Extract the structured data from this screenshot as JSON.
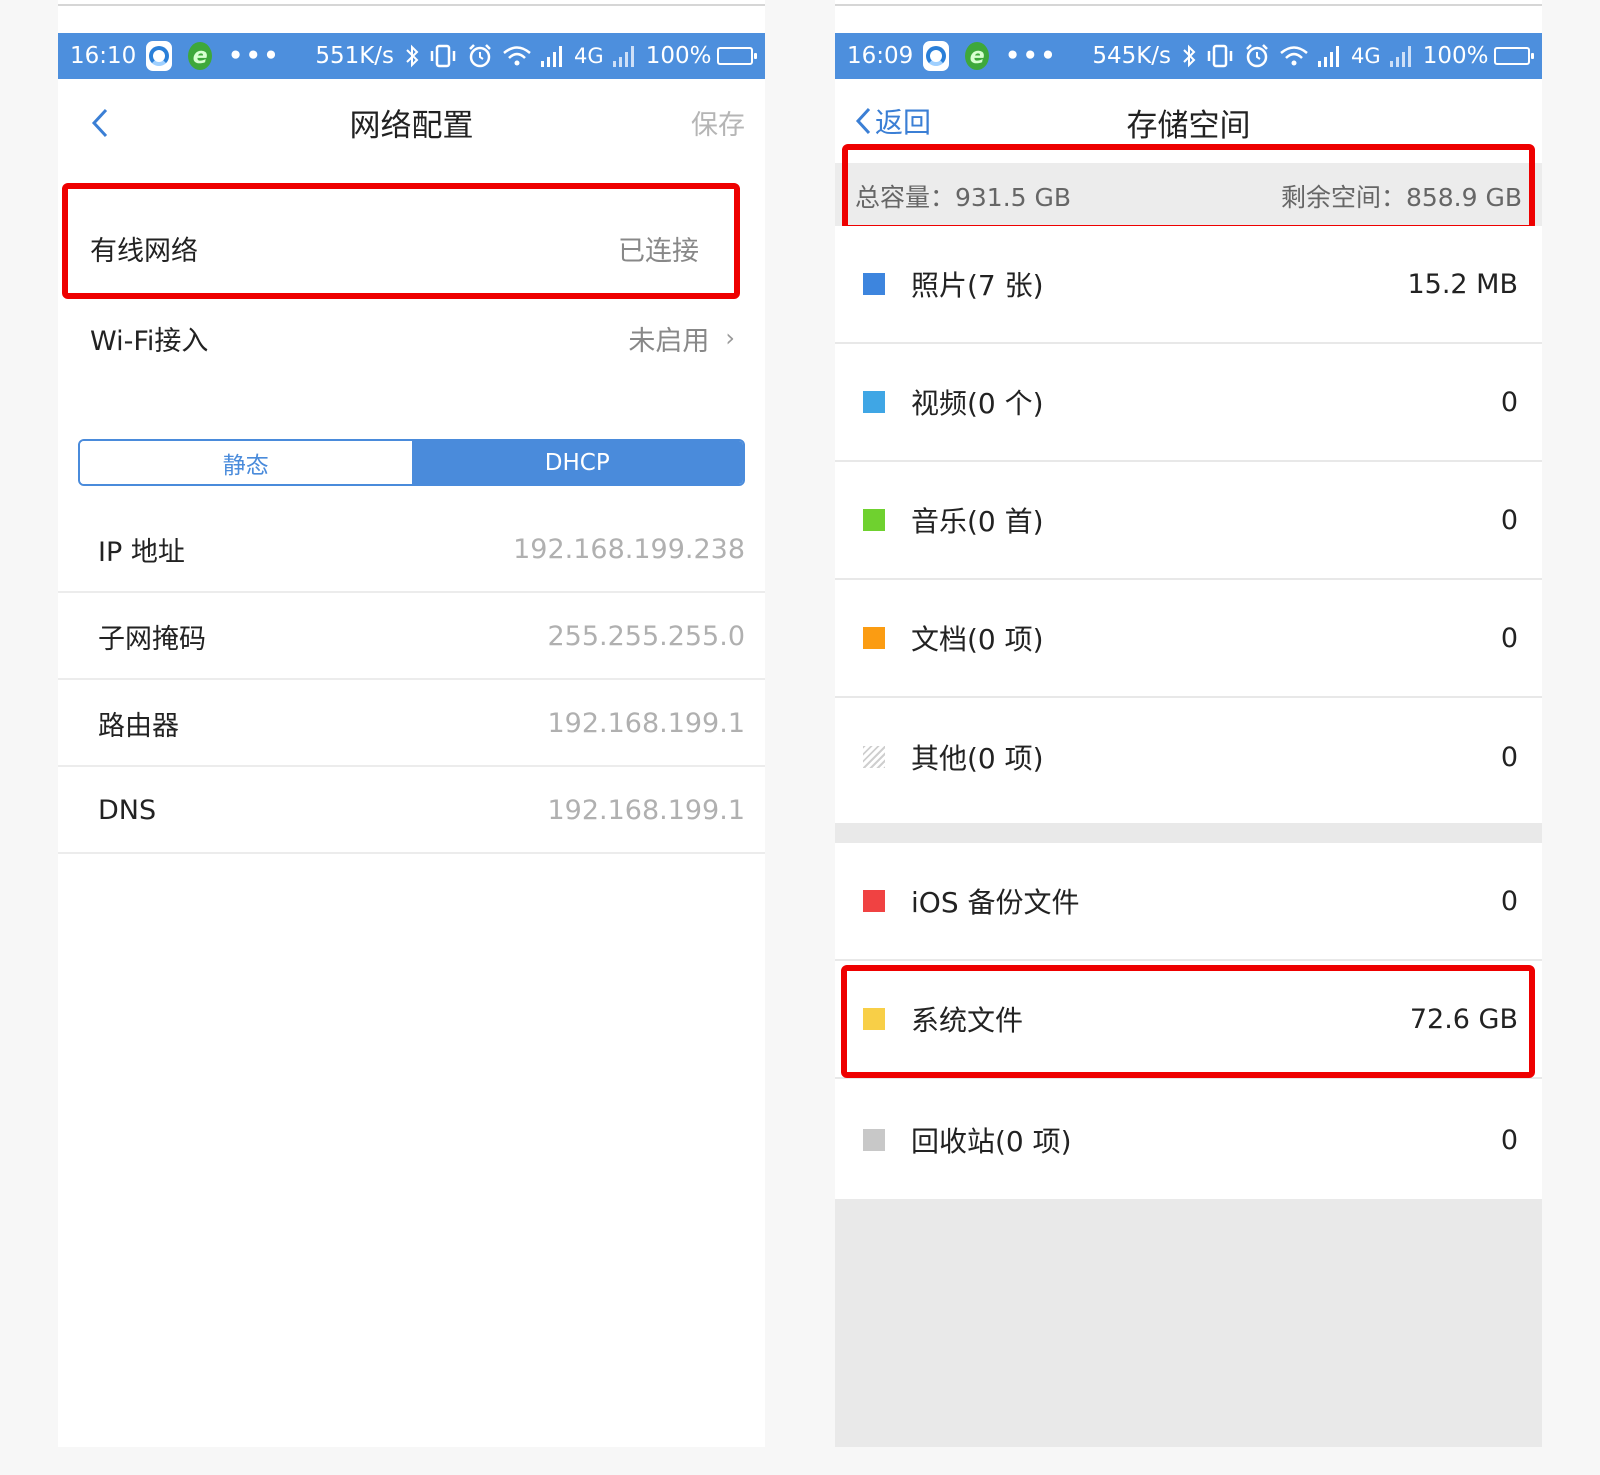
{
  "left": {
    "status": {
      "time": "16:10",
      "speed": "551K/s",
      "network": "4G",
      "battery": "100%"
    },
    "title": "网络配置",
    "save_label": "保存",
    "wired": {
      "label": "有线网络",
      "value": "已连接"
    },
    "wifi": {
      "label": "Wi-Fi接入",
      "value": "未启用"
    },
    "segments": {
      "static": "静态",
      "dhcp": "DHCP",
      "selected": "DHCP"
    },
    "rows": [
      {
        "label": "IP 地址",
        "value": "192.168.199.238"
      },
      {
        "label": "子网掩码",
        "value": "255.255.255.0"
      },
      {
        "label": "路由器",
        "value": "192.168.199.1"
      },
      {
        "label": "DNS",
        "value": "192.168.199.1"
      }
    ]
  },
  "right": {
    "status": {
      "time": "16:09",
      "speed": "545K/s",
      "network": "4G",
      "battery": "100%"
    },
    "back_label": "返回",
    "title": "存储空间",
    "summary": {
      "total": "总容量：931.5 GB",
      "free": "剩余空间：858.9 GB"
    },
    "categories": [
      {
        "name": "照片(7 张)",
        "value": "15.2 MB",
        "color": "#3d85de"
      },
      {
        "name": "视频(0 个)",
        "value": "0",
        "color": "#3fa6e5"
      },
      {
        "name": "音乐(0 首)",
        "value": "0",
        "color": "#6fd12f"
      },
      {
        "name": "文档(0 项)",
        "value": "0",
        "color": "#fb9c12"
      },
      {
        "name": "其他(0 项)",
        "value": "0",
        "color": "hatched-gray"
      }
    ],
    "backups": [
      {
        "name": "iOS 备份文件",
        "value": "0",
        "color": "#f04242"
      },
      {
        "name": "系统文件",
        "value": "72.6 GB",
        "color": "#f8cf47"
      },
      {
        "name": "回收站(0 项)",
        "value": "0",
        "color": "#c8c8c8"
      }
    ]
  },
  "colors": {
    "accent": "#4d8fdd",
    "highlight": "#e00000"
  }
}
